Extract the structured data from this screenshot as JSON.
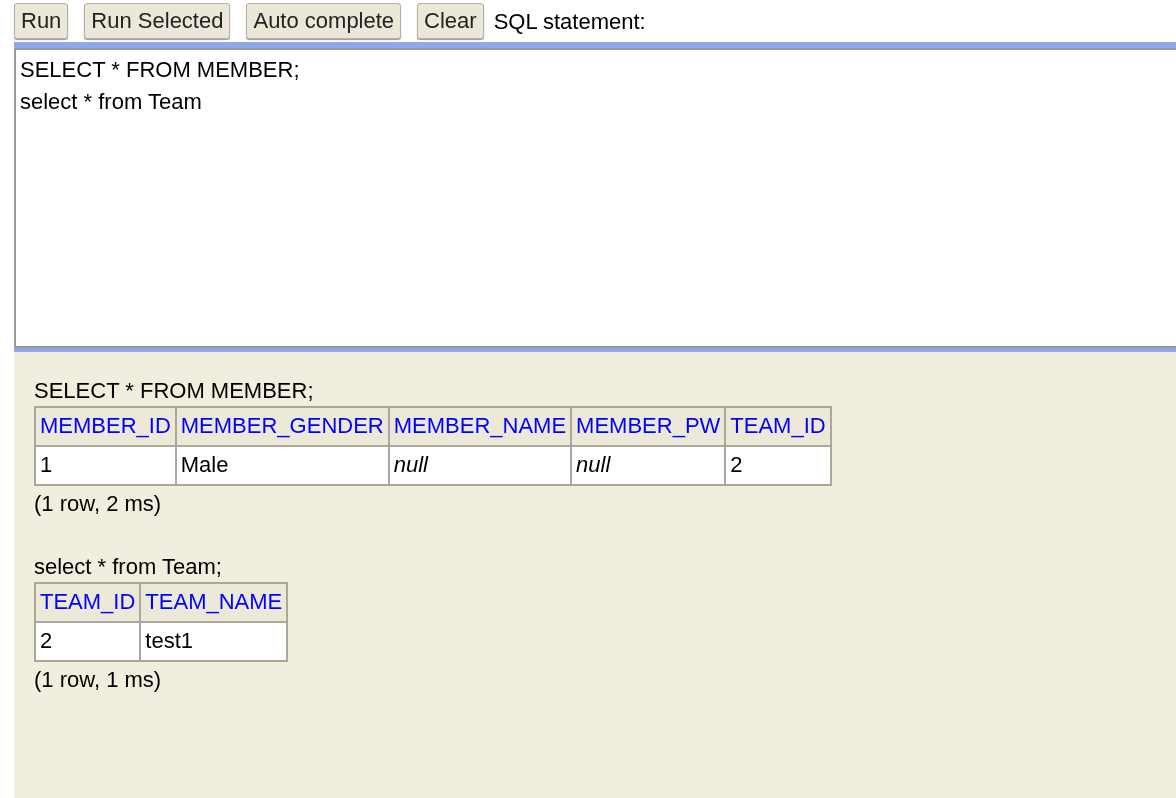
{
  "toolbar": {
    "buttons": [
      "Run",
      "Run Selected",
      "Auto complete",
      "Clear"
    ],
    "label": "SQL statement:"
  },
  "editor": {
    "value": "SELECT * FROM MEMBER;\nselect * from Team"
  },
  "results": [
    {
      "statement": "SELECT * FROM MEMBER;",
      "columns": [
        "MEMBER_ID",
        "MEMBER_GENDER",
        "MEMBER_NAME",
        "MEMBER_PW",
        "TEAM_ID"
      ],
      "rows": [
        [
          {
            "text": "1",
            "kind": "value"
          },
          {
            "text": "Male",
            "kind": "value"
          },
          {
            "text": "null",
            "kind": "null"
          },
          {
            "text": "null",
            "kind": "null"
          },
          {
            "text": "2",
            "kind": "value"
          }
        ]
      ],
      "summary": "(1 row, 2 ms)"
    },
    {
      "statement": "select * from Team;",
      "columns": [
        "TEAM_ID",
        "TEAM_NAME"
      ],
      "rows": [
        [
          {
            "text": "2",
            "kind": "value"
          },
          {
            "text": "test1",
            "kind": "value"
          }
        ]
      ],
      "summary": "(1 row, 1 ms)"
    }
  ]
}
